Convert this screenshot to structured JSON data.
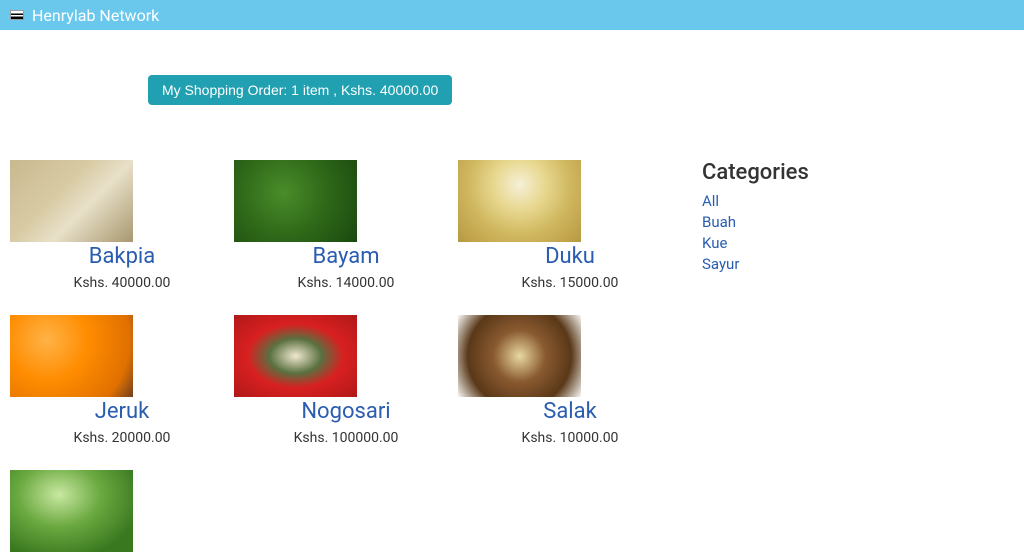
{
  "navbar": {
    "title": "Henrylab Network"
  },
  "cart": {
    "label": "My Shopping Order: 1 item , Kshs. 40000.00"
  },
  "currency_prefix": "Kshs. ",
  "products": [
    {
      "name": "Bakpia",
      "price": "40000.00",
      "img_class": "img-bakpia"
    },
    {
      "name": "Bayam",
      "price": "14000.00",
      "img_class": "img-bayam"
    },
    {
      "name": "Duku",
      "price": "15000.00",
      "img_class": "img-duku"
    },
    {
      "name": "Jeruk",
      "price": "20000.00",
      "img_class": "img-jeruk"
    },
    {
      "name": "Nogosari",
      "price": "100000.00",
      "img_class": "img-nogosari"
    },
    {
      "name": "Salak",
      "price": "10000.00",
      "img_class": "img-salak"
    },
    {
      "name": "",
      "price": "",
      "img_class": "img-sawi",
      "partial": true
    }
  ],
  "sidebar": {
    "heading": "Categories",
    "categories": [
      "All",
      "Buah",
      "Kue",
      "Sayur"
    ]
  }
}
